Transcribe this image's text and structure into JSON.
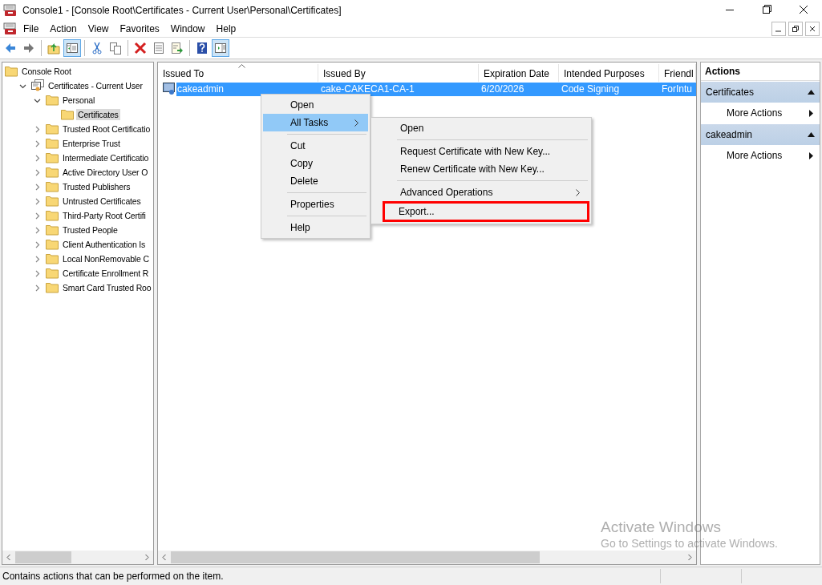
{
  "window": {
    "title": "Console1 - [Console Root\\Certificates - Current User\\Personal\\Certificates]"
  },
  "menu_bar": [
    "File",
    "Action",
    "View",
    "Favorites",
    "Window",
    "Help"
  ],
  "toolbar": [
    {
      "kind": "back",
      "pressed": false
    },
    {
      "kind": "forward",
      "pressed": false
    },
    {
      "kind": "separator"
    },
    {
      "kind": "up",
      "pressed": false
    },
    {
      "kind": "tree",
      "pressed": true
    },
    {
      "kind": "separator"
    },
    {
      "kind": "cut",
      "pressed": false
    },
    {
      "kind": "copy",
      "pressed": false
    },
    {
      "kind": "separator"
    },
    {
      "kind": "delete",
      "pressed": false
    },
    {
      "kind": "properties",
      "pressed": false
    },
    {
      "kind": "export",
      "pressed": false
    },
    {
      "kind": "separator"
    },
    {
      "kind": "help",
      "pressed": false
    },
    {
      "kind": "actionpane",
      "pressed": true
    }
  ],
  "tree": [
    {
      "label": "Console Root",
      "kind": "folder",
      "selected": false,
      "children": [
        {
          "label": "Certificates - Current User",
          "kind": "store",
          "expanded": true,
          "selected": false,
          "children": [
            {
              "label": "Personal",
              "kind": "folder",
              "expanded": true,
              "selected": false,
              "children": [
                {
                  "label": "Certificates",
                  "kind": "folder",
                  "selected": true
                }
              ]
            },
            {
              "label": "Trusted Root Certificatio",
              "kind": "folder",
              "expanded": false,
              "selected": false
            },
            {
              "label": "Enterprise Trust",
              "kind": "folder",
              "expanded": false,
              "selected": false
            },
            {
              "label": "Intermediate Certificatio",
              "kind": "folder",
              "expanded": false,
              "selected": false
            },
            {
              "label": "Active Directory User O",
              "kind": "folder",
              "expanded": false,
              "selected": false
            },
            {
              "label": "Trusted Publishers",
              "kind": "folder",
              "expanded": false,
              "selected": false
            },
            {
              "label": "Untrusted Certificates",
              "kind": "folder",
              "expanded": false,
              "selected": false
            },
            {
              "label": "Third-Party Root Certifi",
              "kind": "folder",
              "expanded": false,
              "selected": false
            },
            {
              "label": "Trusted People",
              "kind": "folder",
              "expanded": false,
              "selected": false
            },
            {
              "label": "Client Authentication Is",
              "kind": "folder",
              "expanded": false,
              "selected": false
            },
            {
              "label": "Local NonRemovable C",
              "kind": "folder",
              "expanded": false,
              "selected": false
            },
            {
              "label": "Certificate Enrollment R",
              "kind": "folder",
              "expanded": false,
              "selected": false
            },
            {
              "label": "Smart Card Trusted Roo",
              "kind": "folder",
              "expanded": false,
              "selected": false
            }
          ]
        }
      ]
    }
  ],
  "table": {
    "columns": [
      {
        "label": "Issued To",
        "sorted": true
      },
      {
        "label": "Issued By",
        "sorted": false
      },
      {
        "label": "Expiration Date",
        "sorted": false
      },
      {
        "label": "Intended Purposes",
        "sorted": false
      },
      {
        "label": "Friendl",
        "sorted": false
      }
    ],
    "rows": [
      {
        "cells": [
          "cakeadmin",
          "cake-CAKECA1-CA-1",
          "6/20/2026",
          "Code Signing",
          "ForIntu"
        ],
        "selected": true
      }
    ]
  },
  "context_menu": [
    {
      "kind": "item",
      "label": "Open",
      "submenu": false,
      "selected": false
    },
    {
      "kind": "item",
      "label": "All Tasks",
      "submenu": true,
      "selected": true
    },
    {
      "kind": "separator"
    },
    {
      "kind": "item",
      "label": "Cut",
      "submenu": false,
      "selected": false
    },
    {
      "kind": "item",
      "label": "Copy",
      "submenu": false,
      "selected": false
    },
    {
      "kind": "item",
      "label": "Delete",
      "submenu": false,
      "selected": false
    },
    {
      "kind": "separator"
    },
    {
      "kind": "item",
      "label": "Properties",
      "submenu": false,
      "selected": false
    },
    {
      "kind": "separator"
    },
    {
      "kind": "item",
      "label": "Help",
      "submenu": false,
      "selected": false
    }
  ],
  "submenu": [
    {
      "kind": "item",
      "label": "Open",
      "submenu": false,
      "highlighted": false
    },
    {
      "kind": "separator"
    },
    {
      "kind": "item",
      "label": "Request Certificate with New Key...",
      "submenu": false,
      "highlighted": false
    },
    {
      "kind": "item",
      "label": "Renew Certificate with New Key...",
      "submenu": false,
      "highlighted": false
    },
    {
      "kind": "separator"
    },
    {
      "kind": "item",
      "label": "Advanced Operations",
      "submenu": true,
      "highlighted": false
    },
    {
      "kind": "item",
      "label": "Export...",
      "submenu": false,
      "highlighted": true
    }
  ],
  "actions": {
    "title": "Actions",
    "sections": [
      {
        "header": "Certificates",
        "items": [
          "More Actions"
        ]
      },
      {
        "header": "cakeadmin",
        "items": [
          "More Actions"
        ]
      }
    ]
  },
  "activation_notice": {
    "title": "Activate Windows",
    "subtitle": "Go to Settings to activate Windows."
  },
  "status_bar": "Contains actions that can be performed on the item."
}
